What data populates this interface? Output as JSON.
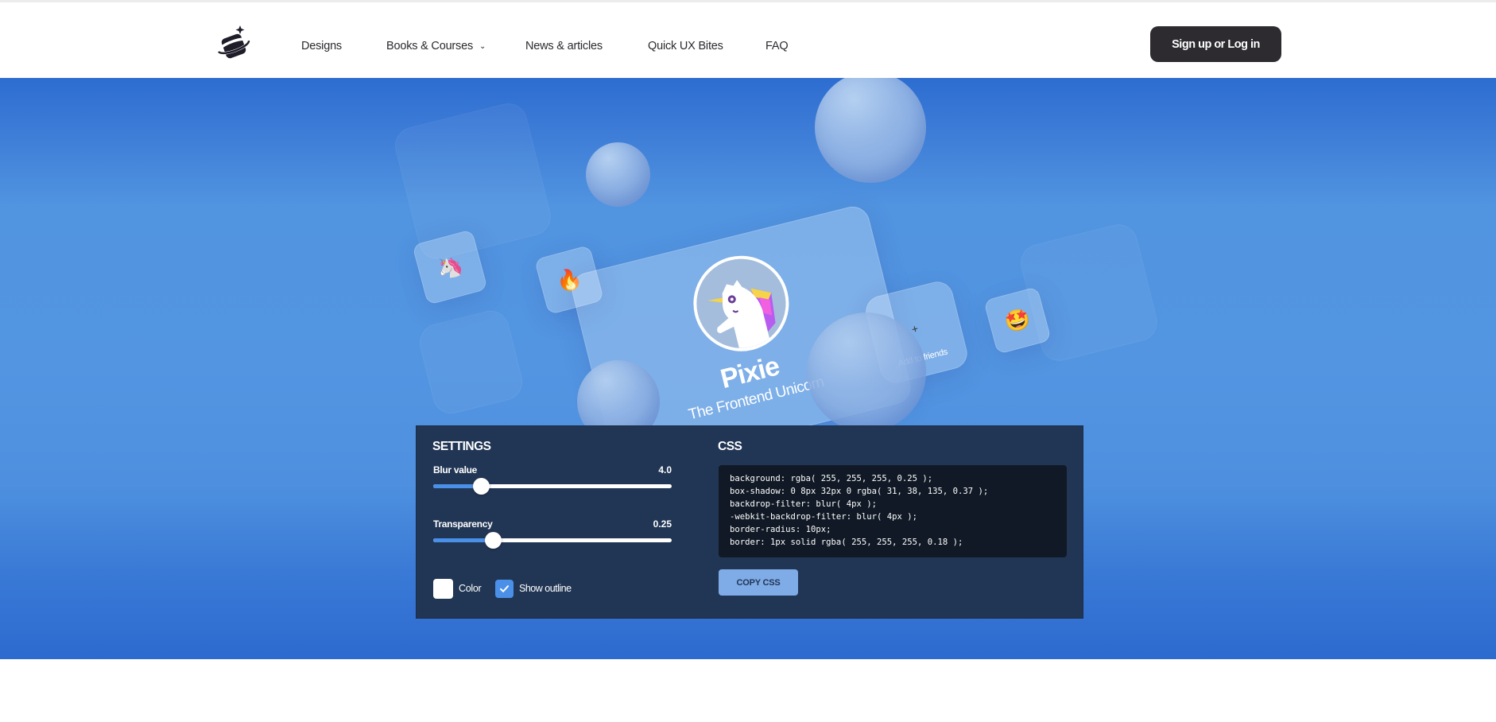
{
  "header": {
    "logo_alt": "planet-logo",
    "nav": [
      {
        "label": "Designs",
        "has_dropdown": false
      },
      {
        "label": "Books & Courses",
        "has_dropdown": true
      },
      {
        "label": "News & articles",
        "has_dropdown": false
      },
      {
        "label": "Quick UX Bites",
        "has_dropdown": false
      },
      {
        "label": "FAQ",
        "has_dropdown": false
      }
    ],
    "chevron_glyph": "⌄",
    "auth_button": "Sign up or Log in"
  },
  "hero": {
    "profile_card": {
      "name": "Pixie",
      "subtitle": "The Frontend Unicorn"
    },
    "friends_card": {
      "plus_glyph": "+",
      "label": "Add to friends"
    },
    "emoji_cards": [
      {
        "icon": "unicorn-icon",
        "glyph": "🦄"
      },
      {
        "icon": "fire-icon",
        "glyph": "🔥"
      },
      {
        "icon": "star-struck-icon",
        "glyph": "🤩"
      }
    ]
  },
  "settings": {
    "title": "SETTINGS",
    "blur": {
      "label": "Blur value",
      "value": "4.0",
      "fraction": 0.2
    },
    "transparency": {
      "label": "Transparency",
      "value": "0.25",
      "fraction": 0.25
    },
    "color_label": "Color",
    "color_value": "#ffffff",
    "show_outline_label": "Show outline",
    "show_outline_checked": true
  },
  "css": {
    "title": "CSS",
    "lines": [
      "background: rgba( 255, 255, 255, 0.25 );",
      "box-shadow: 0 8px 32px 0 rgba( 31, 38, 135, 0.37 );",
      "backdrop-filter: blur( 4px );",
      "-webkit-backdrop-filter: blur( 4px );",
      "border-radius: 10px;",
      "border: 1px solid rgba( 255, 255, 255, 0.18 );"
    ],
    "copy_button": "COPY CSS"
  },
  "colors": {
    "panel_bg": "#213655",
    "accent": "#4a90e8",
    "hero_blue": "#5194e0",
    "button_dark": "#2d2b30"
  }
}
